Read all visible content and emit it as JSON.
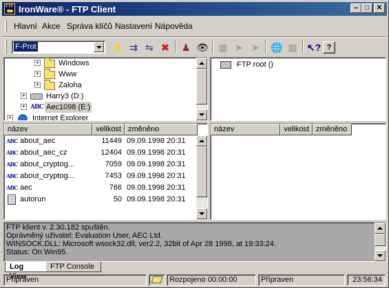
{
  "window": {
    "title": "IronWare® - FTP Client",
    "icon": "ftp-app-icon"
  },
  "menu": [
    "Hlavní",
    "Akce",
    "Správa klíčů",
    "Nastavení",
    "Nápověda"
  ],
  "toolbar": {
    "profile": "F-Prot",
    "buttons": [
      "connect-icon",
      "connect-all-icon",
      "disconnect-icon",
      "cancel-icon",
      "users-icon",
      "view-icon",
      "copy-icon",
      "transfer-up-icon",
      "transfer-down-icon",
      "globe-icon",
      "grid-icon",
      "context-help-icon",
      "help-icon"
    ]
  },
  "local_tree": {
    "rows": [
      {
        "label": "Windows",
        "type": "folder",
        "icon": "folder-icon"
      },
      {
        "label": "Www",
        "type": "folder",
        "icon": "folder-icon"
      },
      {
        "label": "Zaloha",
        "type": "folder",
        "icon": "folder-icon"
      },
      {
        "label": "Harry3 (D:)",
        "type": "drive",
        "icon": "hard-drive-icon"
      },
      {
        "label": "Aec1098 (E:)",
        "type": "abc",
        "icon": "cd-drive-icon"
      },
      {
        "label": "Internet Explorer",
        "type": "ie",
        "icon": "internet-explorer-icon"
      }
    ]
  },
  "remote_tree": {
    "root": "FTP root ()"
  },
  "local_files": {
    "columns": [
      "název",
      "velikost",
      "změněno"
    ],
    "rows": [
      {
        "name": "about_aec",
        "size": "11449",
        "modified": "09.09.1998 20:31",
        "icon": "abc-file-icon"
      },
      {
        "name": "about_aec_cz",
        "size": "12404",
        "modified": "09.09.1998 20:31",
        "icon": "abc-file-icon"
      },
      {
        "name": "about_cryptog...",
        "size": "7059",
        "modified": "09.09.1998 20:31",
        "icon": "abc-file-icon"
      },
      {
        "name": "about_cryptog...",
        "size": "7453",
        "modified": "09.09.1998 20:31",
        "icon": "abc-file-icon"
      },
      {
        "name": "aec",
        "size": "766",
        "modified": "09.09.1998 20:31",
        "icon": "abc-file-icon"
      },
      {
        "name": "autorun",
        "size": "50",
        "modified": "09.09.1998 20:31",
        "icon": "text-file-icon"
      }
    ]
  },
  "remote_files": {
    "columns": [
      "název",
      "velikost",
      "změněno"
    ]
  },
  "log": [
    "FTP klient v. 2.30.182 spuštěn.",
    "Oprávněný uživatel: Evaluation User, AEC Ltd.",
    "WINSOCK.DLL: Microsoft wsock32.dll, ver2.2, 32bit of Apr 28 1998, at 19:33:24.",
    "Status: On Win95."
  ],
  "tabs": [
    "Log View",
    "FTP Console"
  ],
  "status": {
    "left": "Připraven",
    "connection": "Rozpojeno 00:00:00",
    "right": "Připraven",
    "time": "23:56:34"
  }
}
